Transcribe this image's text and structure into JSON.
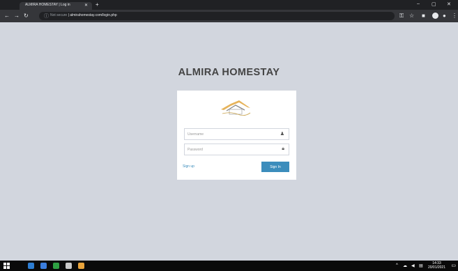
{
  "browser": {
    "tab_title": "ALMIRA HOMESTAY | Log in",
    "tab_close": "✕",
    "new_tab": "+",
    "window_controls": [
      "–",
      "▢",
      "✕"
    ],
    "nav": {
      "back": "←",
      "forward": "→",
      "reload": "↻"
    },
    "url_secure": "Not secure",
    "url": "almirahomestay.com/login.php"
  },
  "page": {
    "brand": "ALMIRA HOMESTAY",
    "username_placeholder": "Username",
    "password_placeholder": "Password",
    "signup_link": "Sign up",
    "signin_button": "Sign In"
  },
  "taskbar": {
    "clock_time": "14:33",
    "clock_date": "20/01/2021",
    "tray_icons": [
      "^",
      "☁",
      "◀",
      "▤"
    ]
  },
  "colors": {
    "page_background": "#d2d6de",
    "button": "#3c8dbc",
    "link": "#3c8dbc",
    "brand_text": "#444444",
    "browser_dark": "#202124"
  }
}
